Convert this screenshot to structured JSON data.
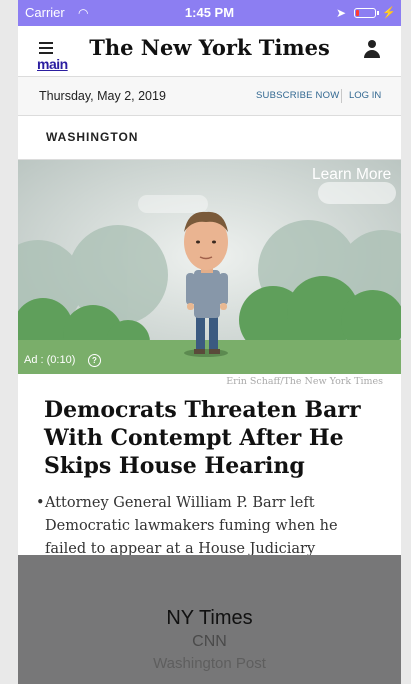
{
  "status_bar": {
    "carrier": "Carrier",
    "time": "1:45 PM"
  },
  "header": {
    "menu_label": "main",
    "logo": "The New York Times"
  },
  "date_bar": {
    "date": "Thursday, May 2, 2019",
    "subscribe": "SUBSCRIBE NOW",
    "login": "LOG IN"
  },
  "section": {
    "label": "WASHINGTON"
  },
  "ad": {
    "learn_more": "Learn More",
    "timer": "Ad : (0:10)"
  },
  "article": {
    "photo_credit": "Erin Schaff/The New York Times",
    "headline": "Democrats Threaten Barr With Contempt After He Skips House Hearing",
    "summary": "Attorney General William P. Barr left Democratic lawmakers fuming when he failed to appear at a House Judiciary"
  },
  "picker": {
    "items": [
      "NY Times",
      "CNN",
      "Washington Post"
    ]
  },
  "colors": {
    "status_bar": "#8c7ef2",
    "link": "#326891",
    "battery_low": "#ff3b30",
    "picker_bg": "#777778"
  },
  "battery": {
    "level": 0.2
  }
}
